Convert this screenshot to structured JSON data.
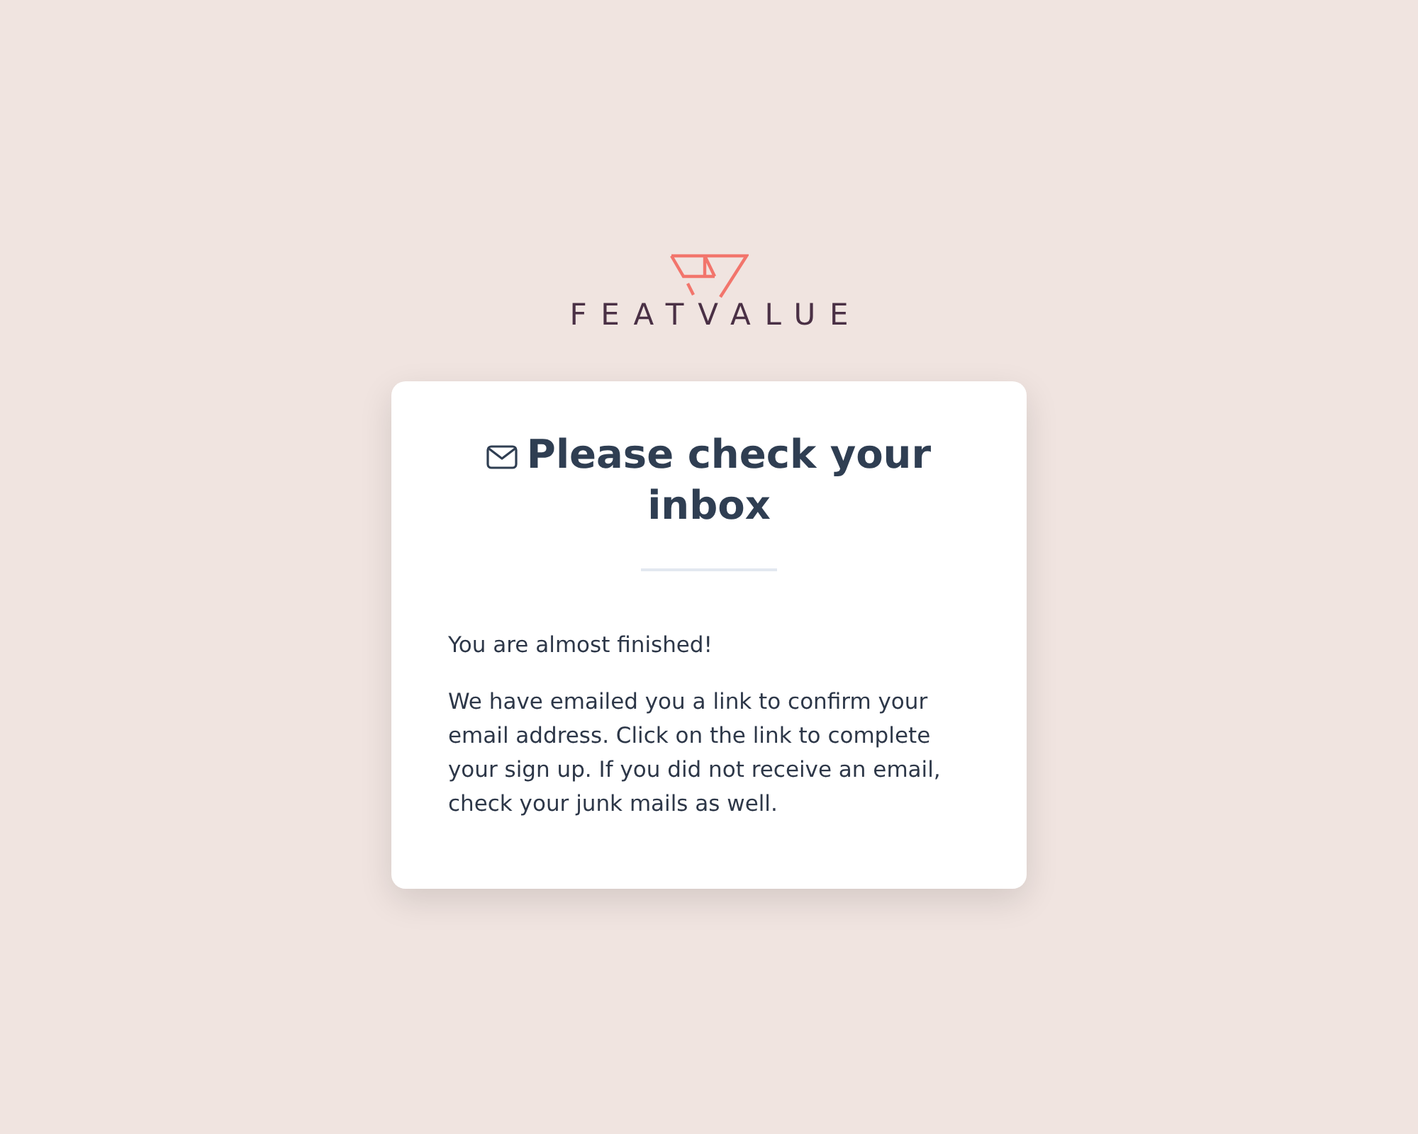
{
  "logo": {
    "wordmark": "FEATVALUE"
  },
  "card": {
    "title": "Please check your inbox",
    "paragraphs": [
      "You are almost finished!",
      "We have emailed you a link to confirm your email address. Click on the link to complete your sign up. If you did not receive an email, check your junk mails as well."
    ]
  }
}
